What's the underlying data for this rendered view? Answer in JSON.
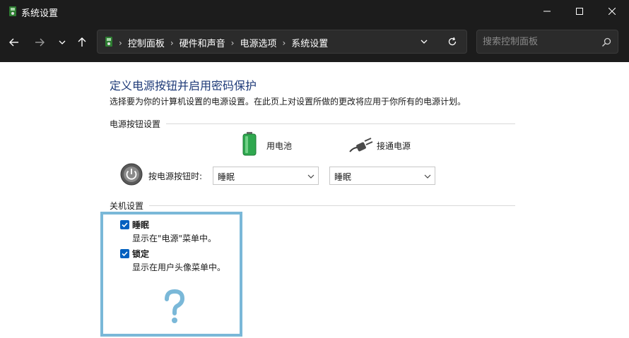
{
  "window": {
    "title": "系统设置",
    "icons": {
      "app": "power-options-icon",
      "minimize": "minimize-icon",
      "maximize": "maximize-icon",
      "close": "close-icon"
    }
  },
  "nav": {
    "icons": {
      "back": "arrow-left-icon",
      "forward": "arrow-right-icon",
      "recent": "chevron-down-icon",
      "up": "arrow-up-icon"
    },
    "breadcrumb": [
      "控制面板",
      "硬件和声音",
      "电源选项",
      "系统设置"
    ],
    "breadcrumb_separator": "›",
    "search": {
      "placeholder": "搜索控制面板",
      "value": ""
    }
  },
  "page": {
    "title": "定义电源按钮并启用密码保护",
    "description": "选择要为你的计算机设置的电源设置。在此页上对设置所做的更改将应用于你所有的电源计划。"
  },
  "power_buttons": {
    "section_label": "电源按钮设置",
    "columns": [
      {
        "label": "用电池",
        "icon": "battery-icon"
      },
      {
        "label": "接通电源",
        "icon": "power-plug-icon"
      }
    ],
    "row": {
      "label": "按电源按钮时:",
      "icon": "power-button-icon",
      "on_battery": "睡眠",
      "plugged_in": "睡眠"
    }
  },
  "shutdown": {
    "section_label": "关机设置",
    "options": [
      {
        "title": "睡眠",
        "description": "显示在\"电源\"菜单中。",
        "checked": true
      },
      {
        "title": "锁定",
        "description": "显示在用户头像菜单中。",
        "checked": true
      }
    ],
    "annotation_icon": "question-mark-icon",
    "annotation_color": "#7ab8d8"
  },
  "colors": {
    "titlebar": "#1c1c1c",
    "title_text": "#1e3a78",
    "checkbox": "#0060c0"
  }
}
